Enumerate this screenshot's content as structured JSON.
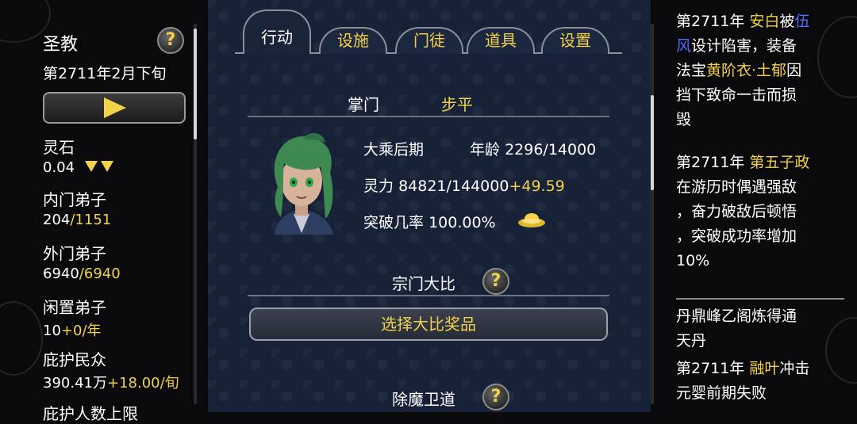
{
  "left": {
    "sect_name": "圣教",
    "date": "第2711年2月下旬",
    "help_glyph": "?",
    "stats": [
      {
        "label": "灵石",
        "value": "0.04"
      },
      {
        "label": "内门弟子",
        "value": "204",
        "extra": "/1151"
      },
      {
        "label": "外门弟子",
        "value": "6940",
        "extra": "/6940"
      },
      {
        "label": "闲置弟子",
        "value": "10",
        "extra": "+0/年"
      },
      {
        "label": "庇护民众",
        "value": "390.41万",
        "extra": "+18.00/旬"
      },
      {
        "label": "庇护人数上限"
      }
    ]
  },
  "tabs": [
    "行动",
    "设施",
    "门徒",
    "道具",
    "设置"
  ],
  "leader": {
    "title": "掌门",
    "name": "步平",
    "realm": "大乘后期",
    "age_label": "年龄",
    "age_value": "2296/14000",
    "power_label": "灵力",
    "power_value": "84821/144000",
    "power_rate": "+49.59",
    "breakthrough_label": "突破几率",
    "breakthrough_value": "100.00%"
  },
  "tournament": {
    "title": "宗门大比",
    "button": "选择大比奖品"
  },
  "guard": {
    "title": "除魔卫道"
  },
  "log": {
    "e1_a": "第2711年",
    "e1_b": "安白",
    "e1_c": "被",
    "e1_d": "伍",
    "e1_e": "风",
    "e1_f": "设计陷害，装备",
    "e1_g": "法宝",
    "e1_h": "黄阶衣·土郁",
    "e1_i": "因",
    "e1_j": "挡下致命一击而损",
    "e1_k": "毁",
    "e2_a": "第2711年",
    "e2_b": "第五子政",
    "e2_c": "在游历时偶遇强敌",
    "e2_d": "，奋力破敌后顿悟",
    "e2_e": "，突破成功率增加",
    "e2_f": "10%",
    "e3_a": "丹鼎峰乙阁炼得通",
    "e3_b": "天丹",
    "e4_a": "第2711年",
    "e4_b": "融叶",
    "e4_c": "冲击",
    "e4_d": "元婴前期失败"
  },
  "colors": {
    "accent": "#f3d24a",
    "highlight_blue": "#4e6cff",
    "panel": "#172238"
  }
}
